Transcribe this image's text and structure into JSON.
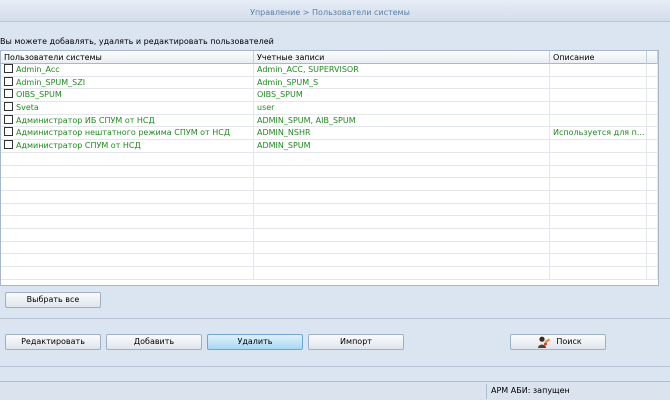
{
  "header": {
    "breadcrumb": "Управление > Пользователи системы"
  },
  "intro": "Вы можете добавлять, удалять и редактировать пользователей",
  "table": {
    "columns": [
      "Пользователи системы",
      "Учетные записи",
      "Описание"
    ],
    "rows": [
      {
        "user": "Admin_Acc",
        "accounts": "Admin_ACC, SUPERVISOR",
        "description": ""
      },
      {
        "user": "Admin_SPUM_SZI",
        "accounts": "Admin_SPUM_S",
        "description": ""
      },
      {
        "user": "OIBS_SPUM",
        "accounts": "OIBS_SPUM",
        "description": ""
      },
      {
        "user": "Sveta",
        "accounts": "user",
        "description": ""
      },
      {
        "user": "Администратор ИБ СПУМ от НСД",
        "accounts": "ADMIN_SPUM, AIB_SPUM",
        "description": ""
      },
      {
        "user": "Администратор нештатного режима СПУМ от НСД",
        "accounts": "ADMIN_NSHR",
        "description": "Используется для п..."
      },
      {
        "user": "Администратор СПУМ от НСД",
        "accounts": "ADMIN_SPUM",
        "description": ""
      }
    ]
  },
  "buttons": {
    "select_all": "Выбрать все",
    "edit": "Редактировать",
    "add": "Добавить",
    "delete": "Удалить",
    "import": "Импорт",
    "search": "Поиск"
  },
  "status": {
    "text": "АРМ АБИ: запущен"
  },
  "colors": {
    "row_text": "#1f8a1f",
    "breadcrumb": "#5c7fa8",
    "active_button": "#a8d8f2"
  }
}
